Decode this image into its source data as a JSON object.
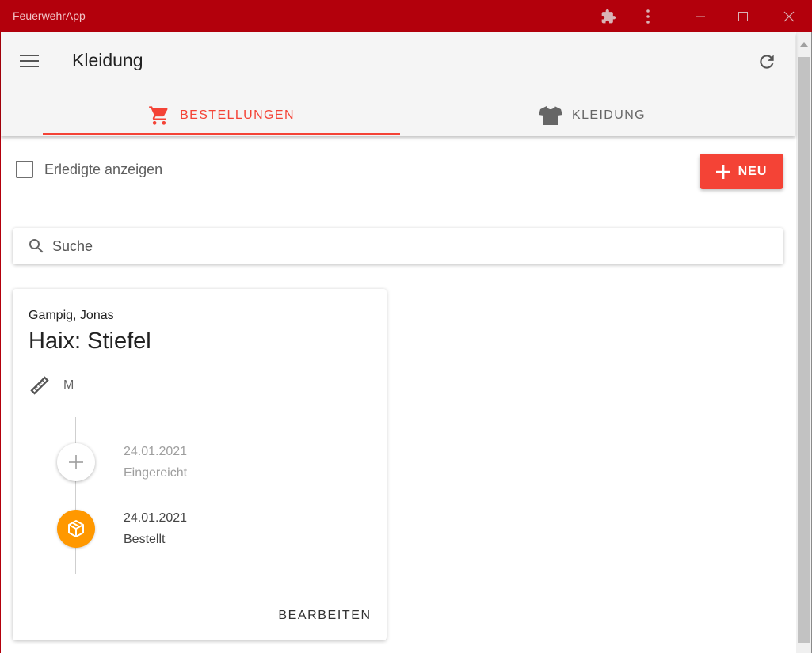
{
  "window": {
    "title": "FeuerwehrApp",
    "accent": "#b3000c"
  },
  "appbar": {
    "title": "Kleidung",
    "menu_icon": "menu-icon",
    "refresh_icon": "refresh-icon"
  },
  "tabs": [
    {
      "label": "BESTELLUNGEN",
      "icon": "cart-icon",
      "active": true
    },
    {
      "label": "KLEIDUNG",
      "icon": "shirt-icon",
      "active": false
    }
  ],
  "filters": {
    "show_completed_label": "Erledigte anzeigen",
    "show_completed_checked": false
  },
  "new_button": {
    "label": "NEU",
    "icon": "plus-icon"
  },
  "search": {
    "placeholder": "Suche",
    "value": ""
  },
  "orders": [
    {
      "person": "Gampig, Jonas",
      "title": "Haix: Stiefel",
      "size": "M",
      "timeline": [
        {
          "date": "24.01.2021",
          "status": "Eingereicht",
          "icon": "plus-icon"
        },
        {
          "date": "24.01.2021",
          "status": "Bestellt",
          "icon": "package-icon"
        }
      ],
      "edit_label": "BEARBEITEN"
    }
  ],
  "colors": {
    "primary": "#f44336",
    "ordered": "#ff9800"
  }
}
